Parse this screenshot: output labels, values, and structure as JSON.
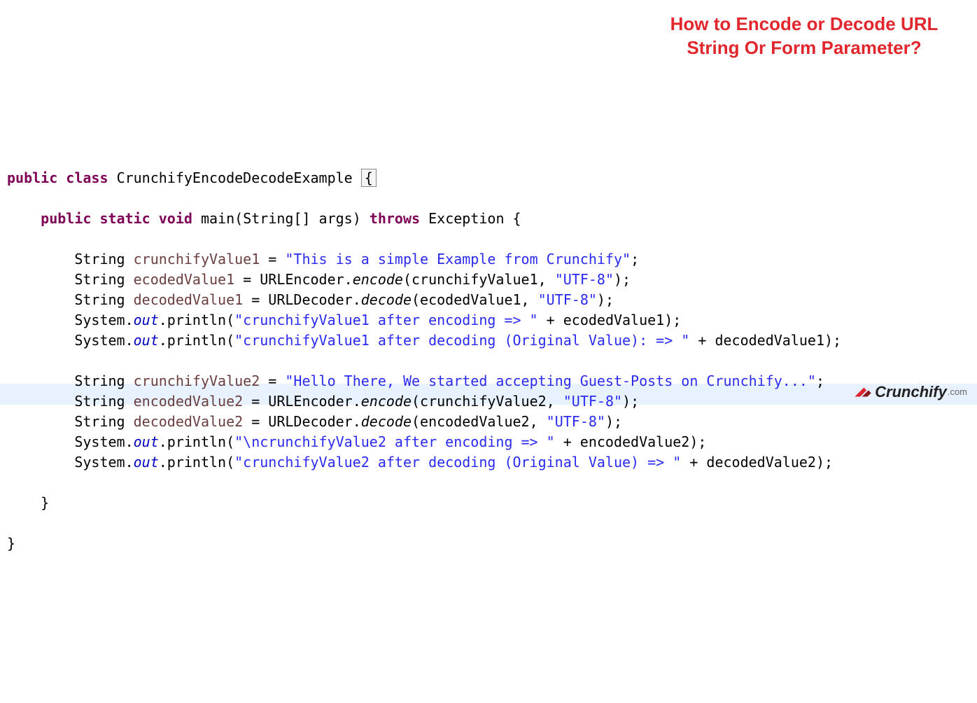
{
  "title": "How to Encode or Decode URL String Or Form Parameter?",
  "logo": {
    "brand": "Crunchify",
    "tld": ".com"
  },
  "code": {
    "kw_public": "public",
    "kw_class": "class",
    "cls_name": "CrunchifyEncodeDecodeExample",
    "kw_static": "static",
    "kw_void": "void",
    "m_main": "main(String[] args)",
    "kw_throws": "throws",
    "m_exc": "Exception {",
    "t_String": "String",
    "v_cv1": "crunchifyValue1",
    "s_cv1": "\"This is a simple Example from Crunchify\"",
    "v_ec1": "ecodedValue1",
    "v_dc1": "decodedValue1",
    "c_URLEncoder": "URLEncoder.",
    "c_URLDecoder": "URLDecoder.",
    "m_encode": "encode",
    "m_decode": "decode",
    "a_enc1": "(crunchifyValue1, ",
    "a_dec1": "(ecodedValue1, ",
    "s_utf8": "\"UTF-8\"",
    "c_System": "System.",
    "f_out": "out",
    "c_println": ".println(",
    "s_p1": "\"crunchifyValue1 after encoding => \"",
    "op_plus_ec1": " + ecodedValue1);",
    "s_p2": "\"crunchifyValue1 after decoding (Original Value): => \"",
    "op_plus_dc1": " + decodedValue1);",
    "v_cv2": "crunchifyValue2",
    "s_cv2": "\"Hello There, We started accepting Guest-Posts on Crunchify...\"",
    "v_en2": "encodedValue2",
    "v_dc2": "decodedValue2",
    "a_enc2": "(crunchifyValue2, ",
    "a_dec2": "(encodedValue2, ",
    "s_p3": "\"\\ncrunchifyValue2 after encoding => \"",
    "op_plus_en2": " + encodedValue2);",
    "s_p4": "\"crunchifyValue2 after decoding (Original Value) => \"",
    "op_plus_dc2": " + decodedValue2);",
    "close_paren": ");",
    "eq": " = ",
    "semi": ";",
    "brace_open": "{",
    "brace_close": "}"
  }
}
